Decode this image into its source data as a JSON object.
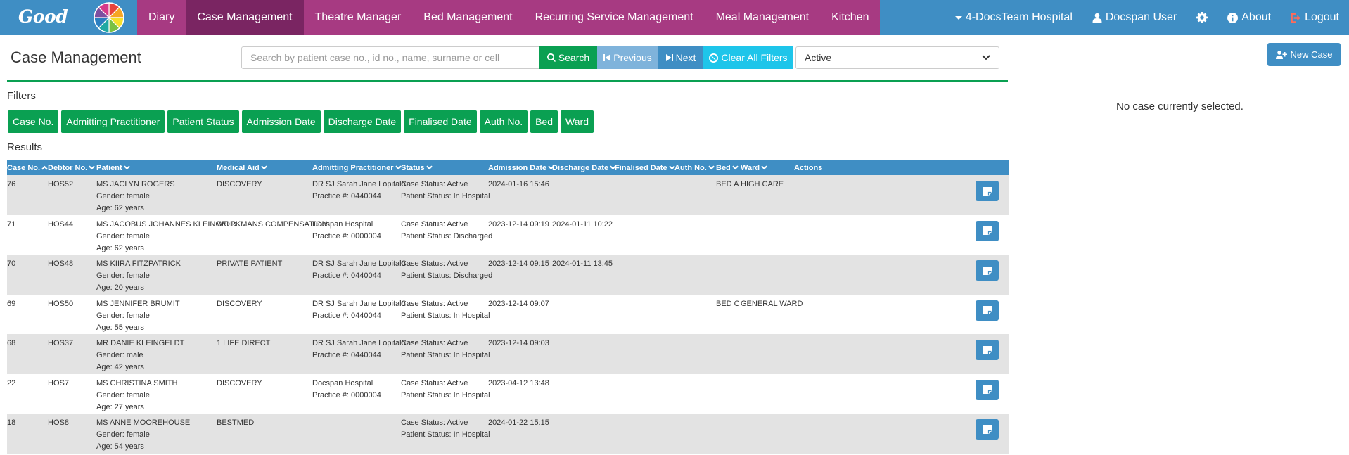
{
  "brand": {
    "name": "Good",
    "wheel_colors": [
      "#e8443a",
      "#f6a623",
      "#f5e02b",
      "#7ac143",
      "#1fa9a3",
      "#2b7fc1",
      "#7d4fa0",
      "#d63a8a"
    ]
  },
  "nav": {
    "items": [
      {
        "label": "Diary",
        "active": false
      },
      {
        "label": "Case Management",
        "active": true
      },
      {
        "label": "Theatre Manager",
        "active": false
      },
      {
        "label": "Bed Management",
        "active": false
      },
      {
        "label": "Recurring Service Management",
        "active": false
      },
      {
        "label": "Meal Management",
        "active": false
      },
      {
        "label": "Kitchen",
        "active": false
      }
    ],
    "hospital": "4-DocsTeam Hospital",
    "user": "Docspan User",
    "about": "About",
    "logout": "Logout"
  },
  "page": {
    "title": "Case Management",
    "search_placeholder": "Search by patient case no., id no., name, surname or cell",
    "search_button": "Search",
    "previous_button": "Previous",
    "next_button": "Next",
    "clear_button": "Clear All Filters",
    "status_select": "Active",
    "new_case_button": "New Case",
    "filters_label": "Filters",
    "results_label": "Results",
    "no_case_text": "No case currently selected."
  },
  "filters": [
    "Case No.",
    "Admitting Practitioner",
    "Patient Status",
    "Admission Date",
    "Discharge Date",
    "Finalised Date",
    "Auth No.",
    "Bed",
    "Ward"
  ],
  "table": {
    "columns": [
      "Case No.",
      "Debtor No.",
      "Patient",
      "Medical Aid",
      "Admitting Practitioner",
      "Status",
      "Admission Date",
      "Discharge Date",
      "Finalised Date",
      "Auth No.",
      "Bed",
      "Ward",
      "Actions"
    ],
    "rows": [
      {
        "case_no": "76",
        "debtor_no": "HOS52",
        "patient_name": "MS JACLYN ROGERS",
        "gender": "Gender: female",
        "age": "Age: 62 years",
        "medical_aid": "DISCOVERY",
        "practitioner": "DR SJ Sarah Jane Lopitalo",
        "practice": "Practice #: 0440044",
        "case_status": "Case Status: Active",
        "patient_status": "Patient Status: In Hospital",
        "admission": "2024-01-16 15:46",
        "discharge": "",
        "finalised": "",
        "auth_no": "",
        "bed": "BED A",
        "ward": "HIGH CARE"
      },
      {
        "case_no": "71",
        "debtor_no": "HOS44",
        "patient_name": "MS JACOBUS JOHANNES KLEINGELD",
        "gender": "Gender: female",
        "age": "Age: 62 years",
        "medical_aid": "WORKMANS COMPENSATION",
        "practitioner": "Docspan Hospital",
        "practice": "Practice #: 0000004",
        "case_status": "Case Status: Active",
        "patient_status": "Patient Status: Discharged",
        "admission": "2023-12-14 09:19",
        "discharge": "2024-01-11 10:22",
        "finalised": "",
        "auth_no": "",
        "bed": "",
        "ward": ""
      },
      {
        "case_no": "70",
        "debtor_no": "HOS48",
        "patient_name": "MS KIIRA FITZPATRICK",
        "gender": "Gender: female",
        "age": "Age: 20 years",
        "medical_aid": "PRIVATE PATIENT",
        "practitioner": "DR SJ Sarah Jane Lopitalo",
        "practice": "Practice #: 0440044",
        "case_status": "Case Status: Active",
        "patient_status": "Patient Status: Discharged",
        "admission": "2023-12-14 09:15",
        "discharge": "2024-01-11 13:45",
        "finalised": "",
        "auth_no": "",
        "bed": "",
        "ward": ""
      },
      {
        "case_no": "69",
        "debtor_no": "HOS50",
        "patient_name": "MS JENNIFER BRUMIT",
        "gender": "Gender: female",
        "age": "Age: 55 years",
        "medical_aid": "DISCOVERY",
        "practitioner": "DR SJ Sarah Jane Lopitalo",
        "practice": "Practice #: 0440044",
        "case_status": "Case Status: Active",
        "patient_status": "Patient Status: In Hospital",
        "admission": "2023-12-14 09:07",
        "discharge": "",
        "finalised": "",
        "auth_no": "",
        "bed": "BED C",
        "ward": "GENERAL WARD"
      },
      {
        "case_no": "68",
        "debtor_no": "HOS37",
        "patient_name": "MR DANIE KLEINGELDT",
        "gender": "Gender: male",
        "age": "Age: 42 years",
        "medical_aid": "1 LIFE DIRECT",
        "practitioner": "DR SJ Sarah Jane Lopitalo",
        "practice": "Practice #: 0440044",
        "case_status": "Case Status: Active",
        "patient_status": "Patient Status: In Hospital",
        "admission": "2023-12-14 09:03",
        "discharge": "",
        "finalised": "",
        "auth_no": "",
        "bed": "",
        "ward": ""
      },
      {
        "case_no": "22",
        "debtor_no": "HOS7",
        "patient_name": "MS CHRISTINA SMITH",
        "gender": "Gender: female",
        "age": "Age: 27 years",
        "medical_aid": "DISCOVERY",
        "practitioner": "Docspan Hospital",
        "practice": "Practice #: 0000004",
        "case_status": "Case Status: Active",
        "patient_status": "Patient Status: In Hospital",
        "admission": "2023-04-12 13:48",
        "discharge": "",
        "finalised": "",
        "auth_no": "",
        "bed": "",
        "ward": ""
      },
      {
        "case_no": "18",
        "debtor_no": "HOS8",
        "patient_name": "MS ANNE MOOREHOUSE",
        "gender": "Gender: female",
        "age": "Age: 54 years",
        "medical_aid": "BESTMED",
        "practitioner": "",
        "practice": "",
        "case_status": "Case Status: Active",
        "patient_status": "Patient Status: In Hospital",
        "admission": "2024-01-22 15:15",
        "discharge": "",
        "finalised": "",
        "auth_no": "",
        "bed": "",
        "ward": ""
      }
    ]
  }
}
